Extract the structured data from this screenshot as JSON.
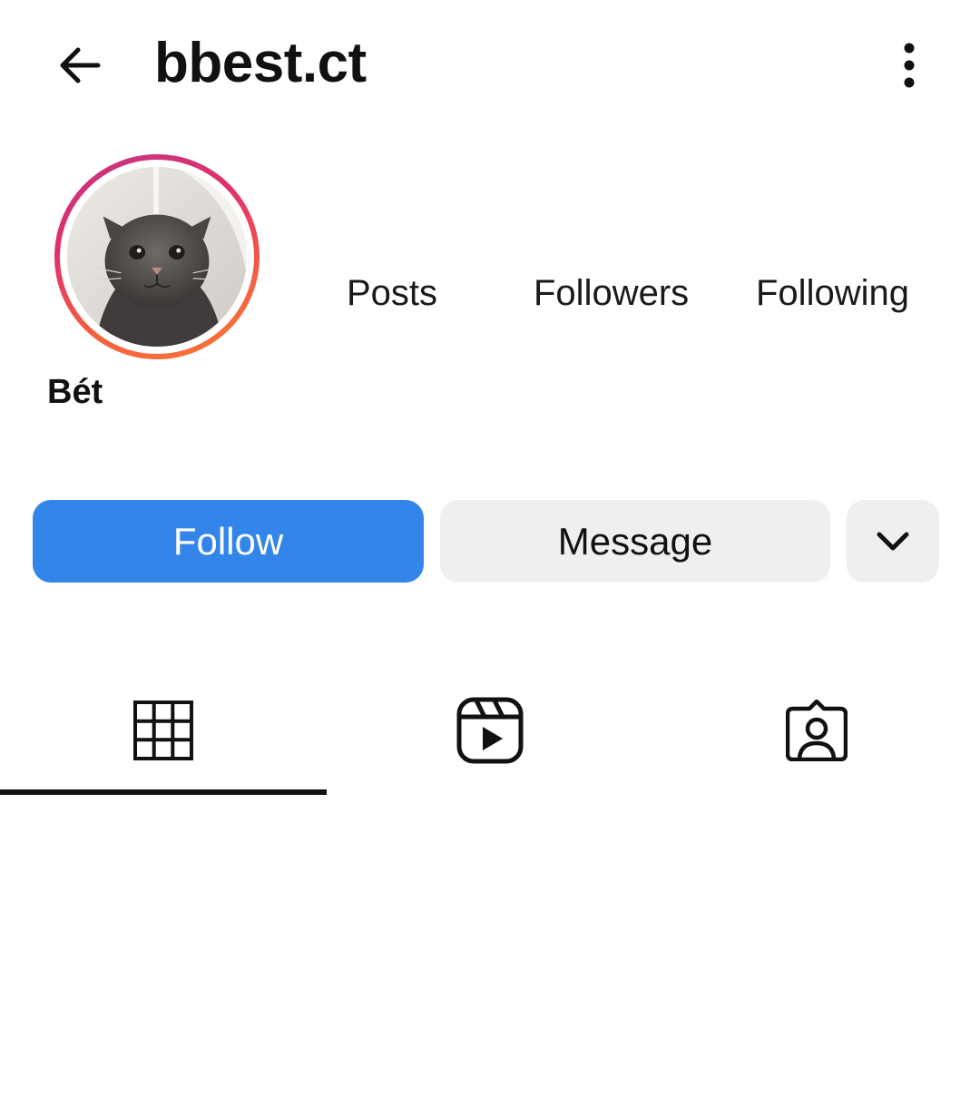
{
  "header": {
    "username": "bbest.ct",
    "back_icon": "arrow-left-icon",
    "more_icon": "kebab-menu-icon"
  },
  "profile": {
    "display_name": "Bét",
    "avatar_ring_colors": [
      "#c13584",
      "#e1306c",
      "#f56040",
      "#f77737"
    ]
  },
  "stats": {
    "posts_label": "Posts",
    "followers_label": "Followers",
    "following_label": "Following"
  },
  "actions": {
    "follow_label": "Follow",
    "message_label": "Message",
    "more_icon": "chevron-down-icon",
    "follow_color": "#3385ea",
    "secondary_color": "#efefef"
  },
  "tabs": [
    {
      "icon": "grid-icon",
      "active": true
    },
    {
      "icon": "reels-icon",
      "active": false
    },
    {
      "icon": "tagged-icon",
      "active": false
    }
  ]
}
